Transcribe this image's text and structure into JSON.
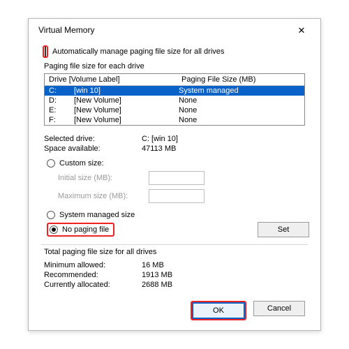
{
  "title": "Virtual Memory",
  "auto_label": "Automatically manage paging file size for all drives",
  "group1_title": "Paging file size for each drive",
  "list_header_drive": "Drive  [Volume Label]",
  "list_header_size": "Paging File Size (MB)",
  "drives": [
    {
      "letter": "C:",
      "label": "[win 10]",
      "size": "System managed"
    },
    {
      "letter": "D:",
      "label": "[New Volume]",
      "size": "None"
    },
    {
      "letter": "E:",
      "label": "[New Volume]",
      "size": "None"
    },
    {
      "letter": "F:",
      "label": "[New Volume]",
      "size": "None"
    }
  ],
  "selected_drive_label": "Selected drive:",
  "selected_drive_value": "C:    [win 10]",
  "space_label": "Space available:",
  "space_value": "47113 MB",
  "custom_size_label": "Custom size:",
  "initial_label": "Initial size (MB):",
  "max_label": "Maximum size (MB):",
  "system_managed_label": "System managed size",
  "no_paging_label": "No paging file",
  "set_label": "Set",
  "totals_title": "Total paging file size for all drives",
  "min_label": "Minimum allowed:",
  "min_value": "16 MB",
  "rec_label": "Recommended:",
  "rec_value": "1913 MB",
  "cur_label": "Currently allocated:",
  "cur_value": "2688 MB",
  "ok_label": "OK",
  "cancel_label": "Cancel"
}
